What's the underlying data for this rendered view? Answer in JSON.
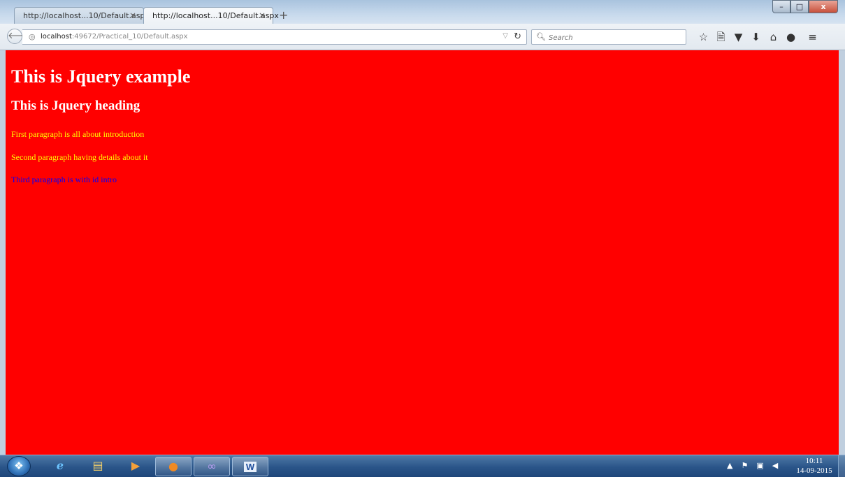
{
  "browser": {
    "tabs": [
      {
        "title": "http://localhost...10/Default.aspx",
        "close": "×"
      },
      {
        "title": "http://localhost...10/Default.aspx",
        "close": "×"
      }
    ],
    "new_tab": "+",
    "window_buttons": {
      "minimize": "–",
      "maximize": "□",
      "close": "x"
    },
    "url_host": "localhost",
    "url_rest": ":49672/Practical_10/Default.aspx",
    "search_placeholder": "Search",
    "toolbar_icons": [
      "star-icon",
      "reading-list-icon",
      "pocket-icon",
      "download-icon",
      "home-icon",
      "chat-icon",
      "menu-icon"
    ]
  },
  "page": {
    "heading1": "This is Jquery example",
    "heading2": "This is Jquery heading",
    "paragraphs": [
      "First paragraph is all about introduction",
      "Second paragraph having details about it",
      "Third paragraph is with id intro"
    ],
    "colors": {
      "background": "#ff0000",
      "heading": "#ffffff",
      "paragraph": "#ffff00",
      "intro_paragraph": "#0000ff"
    }
  },
  "taskbar": {
    "apps": [
      "internet-explorer-icon",
      "file-explorer-icon",
      "media-player-icon",
      "firefox-icon",
      "visual-studio-icon",
      "word-icon"
    ],
    "word_label": "W",
    "time": "10:11",
    "date": "14-09-2015"
  }
}
